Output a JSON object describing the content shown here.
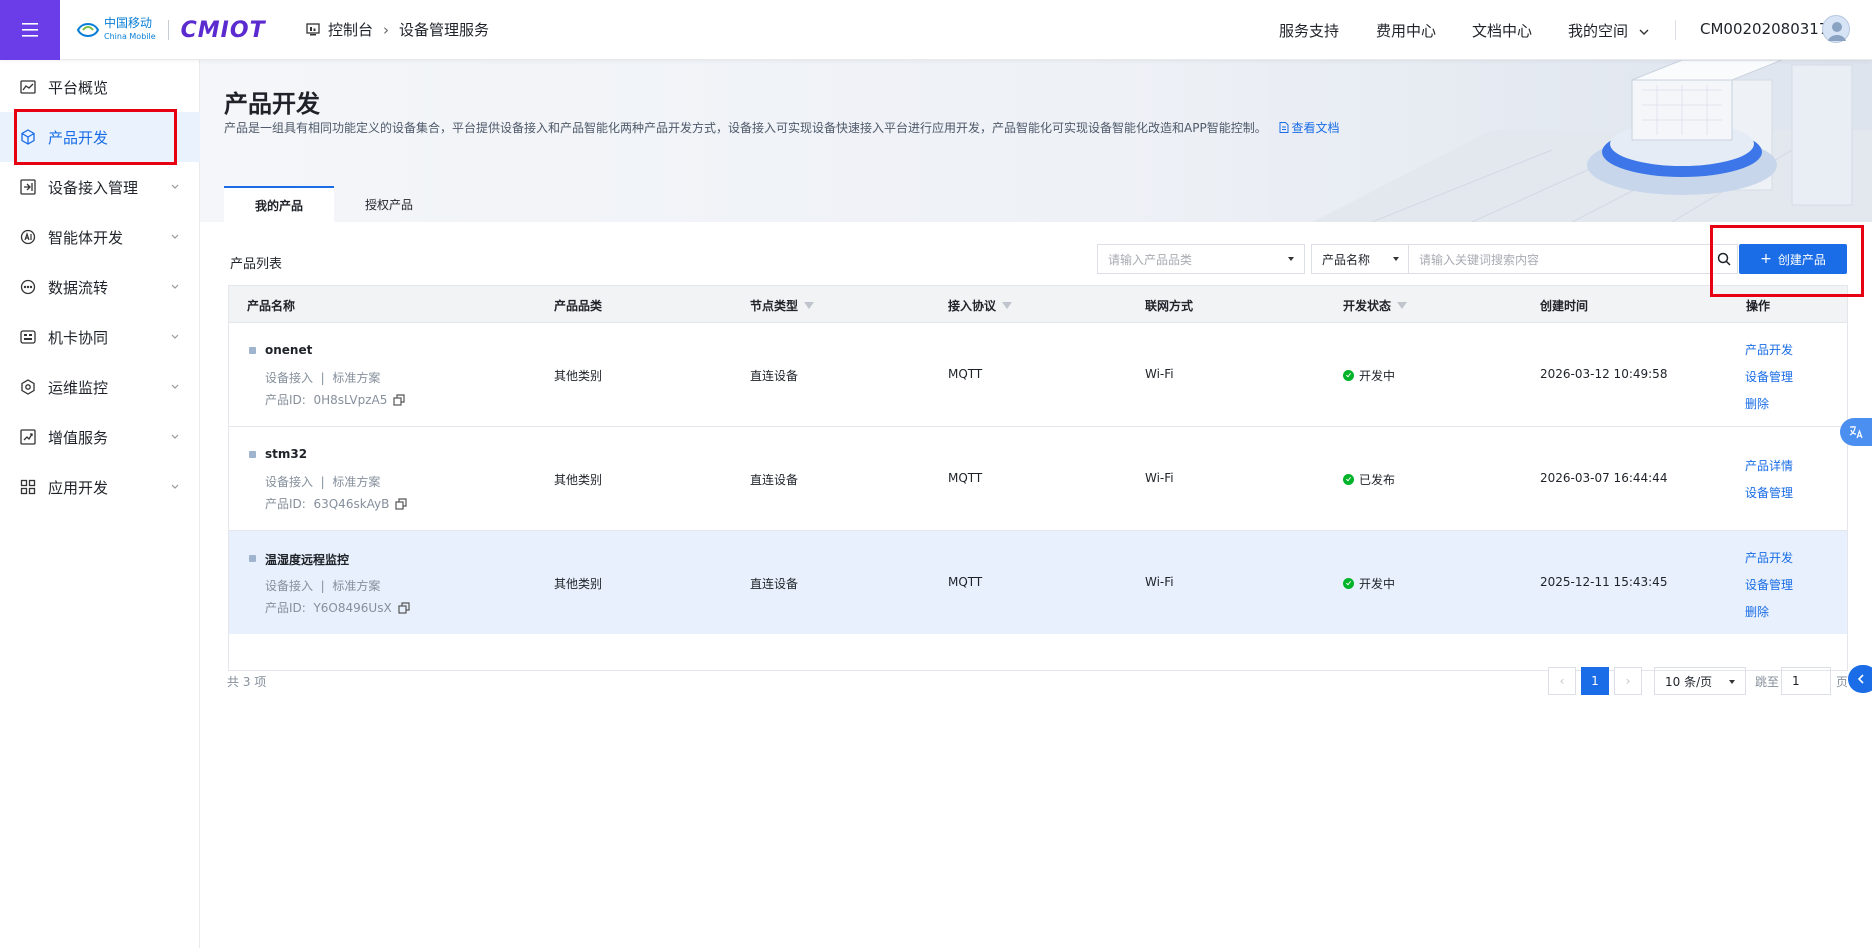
{
  "colors": {
    "brand_purple": "#6a3de8",
    "primary": "#1a6de6",
    "success": "#00b42a",
    "highlight_border": "#e60012"
  },
  "topbar": {
    "logo_cn": "中国移动",
    "logo_en": "China Mobile",
    "logo_brand": "CMIOT",
    "breadcrumb": [
      "控制台",
      "设备管理服务"
    ],
    "nav": [
      "服务支持",
      "费用中心",
      "文档中心",
      "我的空间"
    ],
    "user": "CM002020803172"
  },
  "sidebar": {
    "items": [
      {
        "label": "平台概览",
        "icon": "chart-line-icon",
        "expandable": false
      },
      {
        "label": "产品开发",
        "icon": "cube-icon",
        "expandable": false,
        "active": true
      },
      {
        "label": "设备接入管理",
        "icon": "login-icon",
        "expandable": true
      },
      {
        "label": "智能体开发",
        "icon": "ai-icon",
        "expandable": true
      },
      {
        "label": "数据流转",
        "icon": "flow-icon",
        "expandable": true
      },
      {
        "label": "机卡协同",
        "icon": "sim-card-icon",
        "expandable": true
      },
      {
        "label": "运维监控",
        "icon": "monitor-icon",
        "expandable": true
      },
      {
        "label": "增值服务",
        "icon": "trend-icon",
        "expandable": true
      },
      {
        "label": "应用开发",
        "icon": "apps-icon",
        "expandable": true
      }
    ]
  },
  "page": {
    "title": "产品开发",
    "description": "产品是一组具有相同功能定义的设备集合，平台提供设备接入和产品智能化两种产品开发方式，设备接入可实现设备快速接入平台进行应用开发，产品智能化可实现设备智能化改造和APP智能控制。",
    "doc_link": "查看文档",
    "tabs": [
      "我的产品",
      "授权产品"
    ],
    "active_tab": 0
  },
  "toolbar": {
    "list_title": "产品列表",
    "category_placeholder": "请输入产品品类",
    "search_field": "产品名称",
    "keyword_placeholder": "请输入关键词搜索内容",
    "create_label": "创建产品"
  },
  "table": {
    "columns": [
      "产品名称",
      "产品品类",
      "节点类型",
      "接入协议",
      "联网方式",
      "开发状态",
      "创建时间",
      "操作"
    ],
    "rows": [
      {
        "name": "onenet",
        "meta_a": "设备接入",
        "meta_b": "标准方案",
        "id_label": "产品ID:",
        "id": "0H8sLVpzA5",
        "category": "其他类别",
        "node": "直连设备",
        "protocol": "MQTT",
        "network": "Wi-Fi",
        "status": "开发中",
        "created": "2026-03-12 10:49:58",
        "ops": [
          "产品开发",
          "设备管理",
          "删除"
        ]
      },
      {
        "name": "stm32",
        "meta_a": "设备接入",
        "meta_b": "标准方案",
        "id_label": "产品ID:",
        "id": "63Q46skAyB",
        "category": "其他类别",
        "node": "直连设备",
        "protocol": "MQTT",
        "network": "Wi-Fi",
        "status": "已发布",
        "created": "2026-03-07 16:44:44",
        "ops": [
          "产品详情",
          "设备管理"
        ]
      },
      {
        "name": "温湿度远程监控",
        "meta_a": "设备接入",
        "meta_b": "标准方案",
        "id_label": "产品ID:",
        "id": "Y6O8496UsX",
        "category": "其他类别",
        "node": "直连设备",
        "protocol": "MQTT",
        "network": "Wi-Fi",
        "status": "开发中",
        "created": "2025-12-11 15:43:45",
        "ops": [
          "产品开发",
          "设备管理",
          "删除"
        ]
      }
    ]
  },
  "pagination": {
    "total": "共 3 项",
    "current": "1",
    "page_size": "10 条/页",
    "jump_label": "跳至",
    "jump_value": "1",
    "page_suffix": "页"
  }
}
